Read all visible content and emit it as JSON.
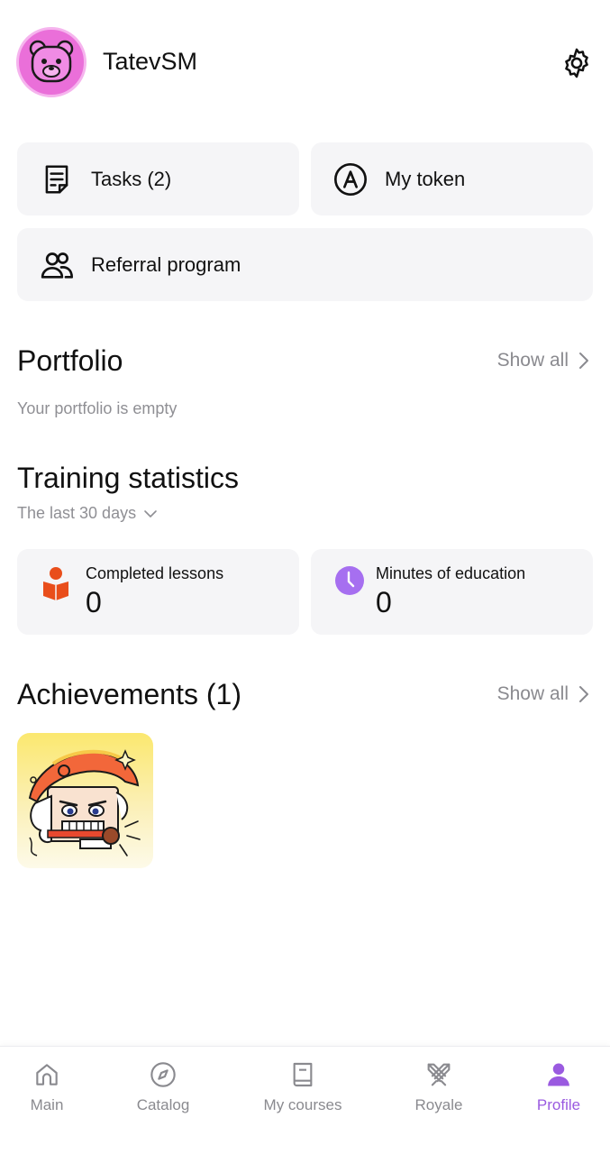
{
  "user": {
    "name": "TatevSM"
  },
  "quick_actions": {
    "tasks_label": "Tasks (2)",
    "token_label": "My token",
    "referral_label": "Referral program"
  },
  "portfolio": {
    "title": "Portfolio",
    "show_all": "Show all",
    "empty_text": "Your portfolio is empty"
  },
  "training_statistics": {
    "title": "Training statistics",
    "period": "The last 30 days",
    "completed_lessons_label": "Completed lessons",
    "completed_lessons_value": "0",
    "minutes_label": "Minutes of education",
    "minutes_value": "0"
  },
  "achievements": {
    "title": "Achievements (1)",
    "show_all": "Show all"
  },
  "bottom_nav": {
    "items": [
      {
        "label": "Main",
        "icon": "home-icon"
      },
      {
        "label": "Catalog",
        "icon": "compass-icon"
      },
      {
        "label": "My courses",
        "icon": "book-icon"
      },
      {
        "label": "Royale",
        "icon": "crossed-swords-icon"
      },
      {
        "label": "Profile",
        "icon": "person-icon",
        "active": true
      }
    ]
  },
  "colors": {
    "accent": "#9a5ae0",
    "avatar_bg": "#ea6fd9",
    "lessons_icon": "#e94e1b",
    "minutes_icon": "#a66ff0",
    "card_bg": "#f5f5f7"
  }
}
